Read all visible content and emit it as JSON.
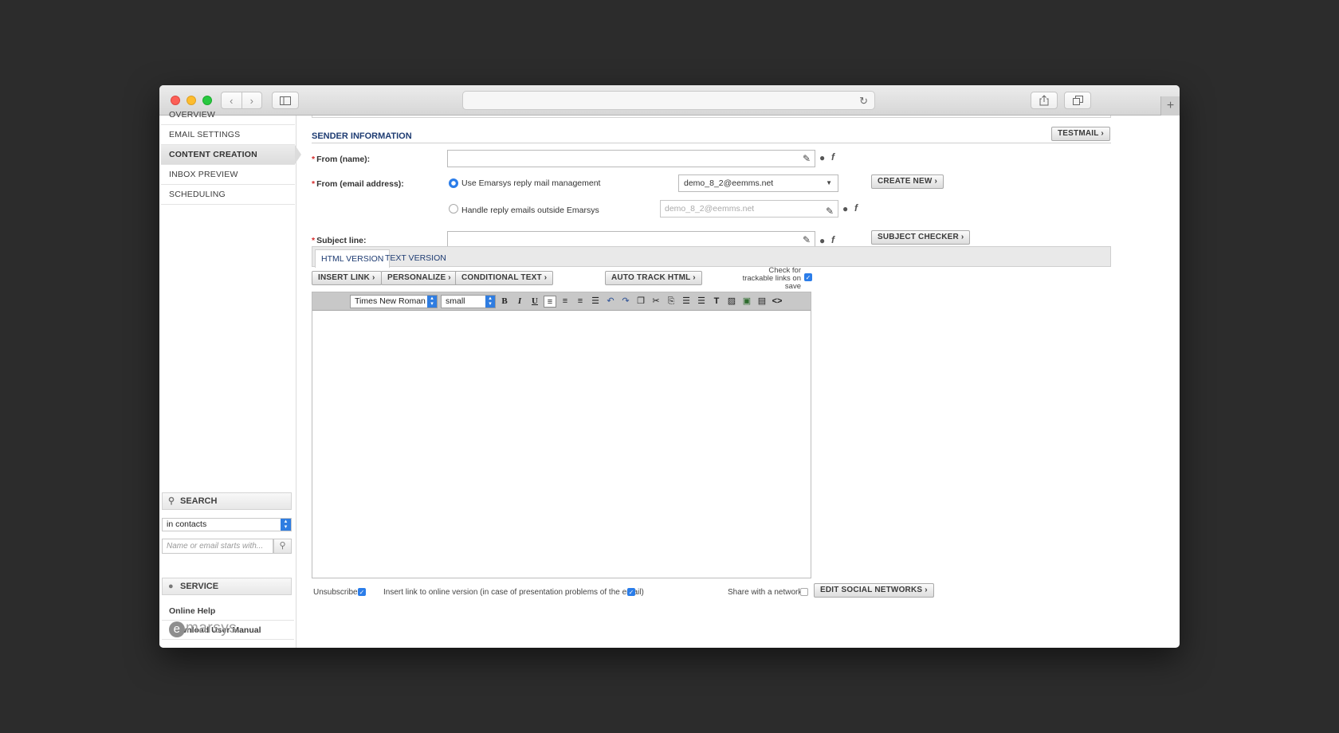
{
  "browser": {
    "back_icon": "chevron-left-icon",
    "forward_icon": "chevron-right-icon",
    "reload_icon": "reload-icon"
  },
  "sidebar": {
    "nav": [
      {
        "label": "OVERVIEW"
      },
      {
        "label": "EMAIL SETTINGS"
      },
      {
        "label": "CONTENT CREATION",
        "active": true
      },
      {
        "label": "INBOX PREVIEW"
      },
      {
        "label": "SCHEDULING"
      }
    ],
    "search": {
      "title": "SEARCH",
      "scope": "in contacts",
      "placeholder": "Name or email starts with..."
    },
    "service": {
      "title": "SERVICE",
      "links": [
        "Online Help",
        "Download User Manual"
      ]
    },
    "logo": {
      "initial": "e",
      "rest": "marsys"
    }
  },
  "main": {
    "section_title": "SENDER INFORMATION",
    "testmail_button": "TESTMAIL",
    "from_name_label": "From (name):",
    "from_email_label": "From (email address):",
    "radio_use_emarsys": "Use Emarsys reply mail management",
    "radio_handle_outside": "Handle reply emails outside Emarsys",
    "selected_reply_address": "demo_8_2@eemms.net",
    "reply_address_placeholder": "demo_8_2@eemms.net",
    "create_new_button": "CREATE NEW",
    "subject_label": "Subject line:",
    "subject_checker_button": "SUBJECT CHECKER",
    "tabs": [
      {
        "label": "HTML VERSION",
        "active": true
      },
      {
        "label": "TEXT VERSION"
      }
    ],
    "insert_link_button": "INSERT LINK",
    "personalize_button": "PERSONALIZE",
    "conditional_text_button": "CONDITIONAL TEXT",
    "auto_track_button": "AUTO TRACK HTML",
    "check_trackable_label": "Check for trackable links on save",
    "check_trackable_checked": true,
    "editor": {
      "font_family": "Times New Roman",
      "font_size": "small"
    },
    "footer": {
      "unsubscribe_label": "Unsubscribe",
      "unsubscribe_checked": true,
      "online_version_label": "Insert link to online version (in case of presentation problems of the email)",
      "online_version_checked": true,
      "share_label": "Share with a network",
      "share_checked": false,
      "edit_social_button": "EDIT SOCIAL NETWORKS"
    }
  },
  "colors": {
    "accent_blue": "#1d3b72",
    "checkbox_blue": "#2b7de9",
    "required_red": "#d62c2c"
  }
}
